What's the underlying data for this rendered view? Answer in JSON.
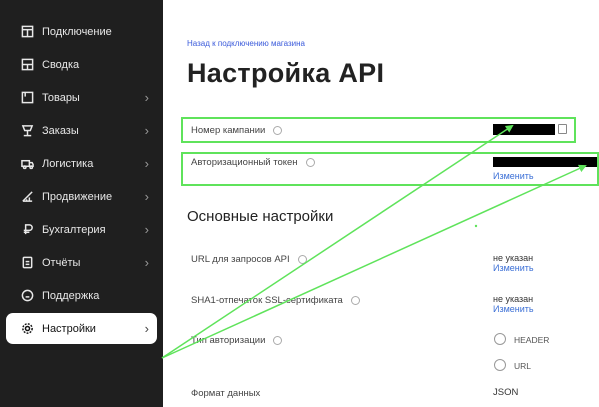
{
  "sidebar": {
    "items": [
      {
        "label": "Подключение",
        "icon": "connection-icon",
        "chevron": ""
      },
      {
        "label": "Сводка",
        "icon": "summary-icon",
        "chevron": ""
      },
      {
        "label": "Товары",
        "icon": "products-icon",
        "chevron": "›"
      },
      {
        "label": "Заказы",
        "icon": "orders-icon",
        "chevron": "›"
      },
      {
        "label": "Логистика",
        "icon": "logistics-icon",
        "chevron": "›"
      },
      {
        "label": "Продвижение",
        "icon": "promotion-icon",
        "chevron": "›"
      },
      {
        "label": "Бухгалтерия",
        "icon": "accounting-icon",
        "chevron": "›"
      },
      {
        "label": "Отчёты",
        "icon": "reports-icon",
        "chevron": "›"
      },
      {
        "label": "Поддержка",
        "icon": "support-icon",
        "chevron": ""
      },
      {
        "label": "Настройки",
        "icon": "settings-icon",
        "chevron": "›",
        "active": true
      }
    ]
  },
  "main": {
    "back_link": "Назад к подключению магазина",
    "title": "Настройка API",
    "campaign_label": "Номер кампании",
    "token_label": "Авторизационный токен",
    "token_change": "Изменить",
    "section_title": "Основные настройки",
    "url_label": "URL для запросов API",
    "url_value": "не указан",
    "url_change": "Изменить",
    "sha_label": "SHA1-отпечаток SSL-сертификата",
    "sha_value": "не указан",
    "sha_change": "Изменить",
    "auth_label": "Тип авторизации",
    "auth_options": [
      "HEADER",
      "URL"
    ],
    "format_label": "Формат данных",
    "format_value": "JSON"
  },
  "colors": {
    "sidebar_bg": "#1f1f1f",
    "highlight": "#5fe35b",
    "link": "#3b6fd6"
  }
}
